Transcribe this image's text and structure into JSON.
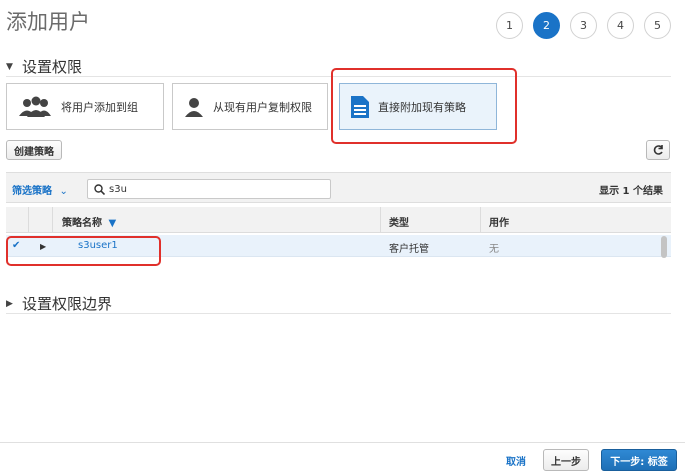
{
  "page": {
    "title": "添加用户"
  },
  "steps": [
    "1",
    "2",
    "3",
    "4",
    "5"
  ],
  "active_step": 2,
  "permissions_section": {
    "title": "设置权限"
  },
  "options": {
    "add_to_group": "将用户添加到组",
    "copy_from_user": "从现有用户复制权限",
    "attach_policies": "直接附加现有策略"
  },
  "toolbar": {
    "create_policy": "创建策略",
    "refresh_icon": "refresh-icon"
  },
  "filter": {
    "label": "筛选策略",
    "search_value": "s3u",
    "results": "显示 1 个结果"
  },
  "table": {
    "headers": {
      "name": "策略名称",
      "type": "类型",
      "used_as": "用作"
    },
    "rows": [
      {
        "selected": true,
        "name": "s3user1",
        "type": "客户托管",
        "used_as": "无"
      }
    ]
  },
  "boundary_section": {
    "title": "设置权限边界"
  },
  "footer": {
    "cancel": "取消",
    "previous": "上一步",
    "next": "下一步: 标签"
  },
  "colors": {
    "accent": "#1a73c7",
    "highlight_box": "#e0302b",
    "selected_row": "#e9f2fb"
  }
}
